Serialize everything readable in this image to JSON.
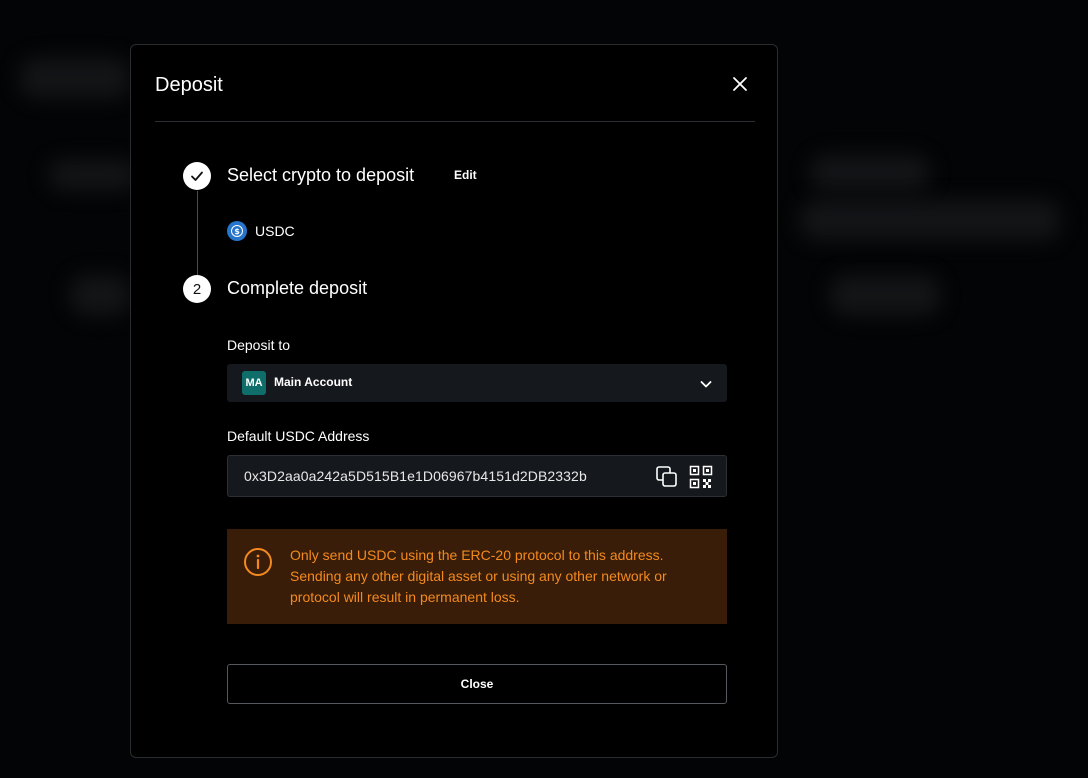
{
  "modal": {
    "title": "Deposit",
    "close_icon": "close-icon"
  },
  "steps": [
    {
      "status": "completed",
      "icon": "checkmark-icon",
      "title": "Select crypto to deposit",
      "edit_label": "Edit",
      "selected_crypto": {
        "label": "USDC",
        "icon": "usdc-coin-icon",
        "color": "#2775ca"
      }
    },
    {
      "status": "active",
      "number": "2",
      "title": "Complete deposit"
    }
  ],
  "deposit_to": {
    "label": "Deposit to",
    "account_initials": "MA",
    "account_name": "Main Account",
    "avatar_color": "#0f6e6a",
    "chevron_icon": "chevron-down-icon"
  },
  "address": {
    "label": "Default USDC Address",
    "value": "0x3D2aa0a242a5D515B1e1D06967b4151d2DB2332b",
    "copy_icon": "copy-icon",
    "qr_icon": "qr-code-icon"
  },
  "warning": {
    "icon": "info-circle-icon",
    "text": "Only send USDC using the ERC-20 protocol to this address. Sending any other digital asset or using any other network or protocol will result in permanent loss.",
    "text_color": "#f38a1f",
    "background": "#3a1d08"
  },
  "footer": {
    "close_label": "Close"
  }
}
